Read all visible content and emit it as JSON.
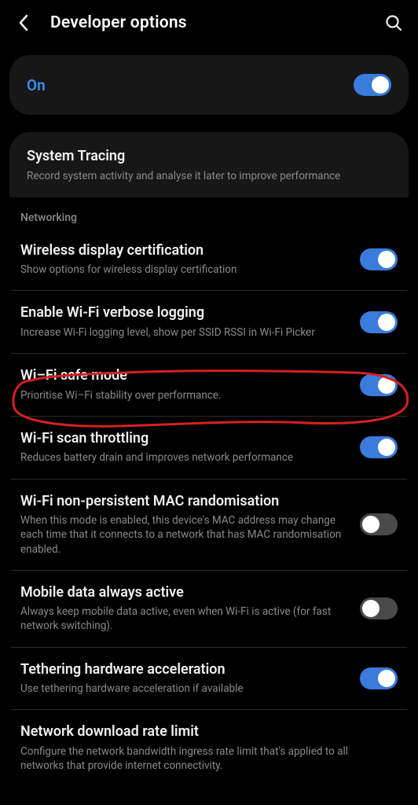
{
  "header": {
    "title": "Developer options"
  },
  "master_toggle": {
    "label": "On",
    "state": "on"
  },
  "tracing": {
    "title": "System Tracing",
    "sub": "Record system activity and analyse it later to improve performance"
  },
  "section_networking": "Networking",
  "rows": [
    {
      "title": "Wireless display certification",
      "sub": "Show options for wireless display certification",
      "toggle": "on"
    },
    {
      "title": "Enable Wi-Fi verbose logging",
      "sub": "Increase Wi-Fi logging level, show per SSID RSSI in Wi-Fi Picker",
      "toggle": "on"
    },
    {
      "title": "Wi–Fi safe mode",
      "sub": "Prioritise Wi–Fi stability over performance.",
      "toggle": "on"
    },
    {
      "title": "Wi-Fi scan throttling",
      "sub": "Reduces battery drain and improves network performance",
      "toggle": "on"
    },
    {
      "title": "Wi-Fi non-persistent MAC randomisation",
      "sub": "When this mode is enabled, this device's MAC address may change each time that it connects to a network that has MAC randomisation enabled.",
      "toggle": "off"
    },
    {
      "title": "Mobile data always active",
      "sub": "Always keep mobile data active, even when Wi-Fi is active (for fast network switching).",
      "toggle": "off"
    },
    {
      "title": "Tethering hardware acceleration",
      "sub": "Use tethering hardware acceleration if available",
      "toggle": "on"
    },
    {
      "title": "Network download rate limit",
      "sub": "Configure the network bandwidth ingress rate limit that's applied to all networks that provide internet connectivity.",
      "toggle": null
    }
  ]
}
